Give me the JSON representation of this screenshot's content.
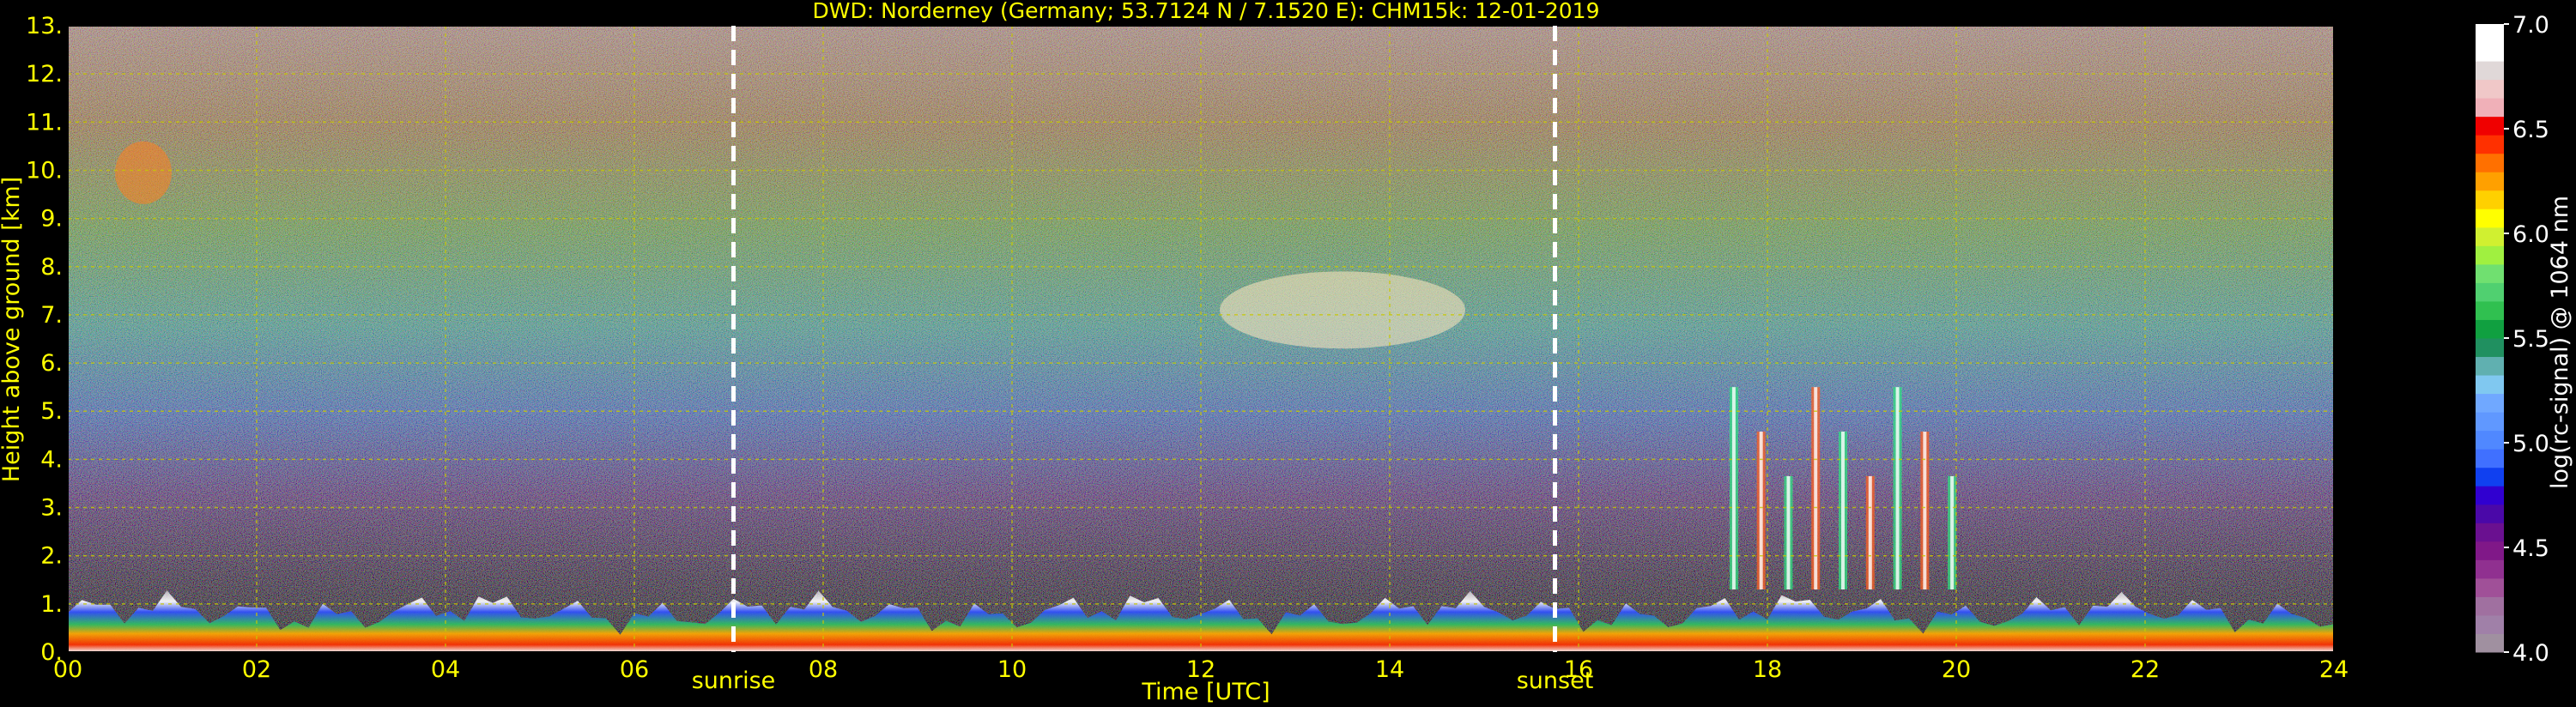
{
  "chart_data": {
    "type": "heatmap",
    "title": "DWD: Norderney (Germany; 53.7124 N / 7.1520 E):    CHM15k: 12-01-2019",
    "xlabel": "Time [UTC]",
    "ylabel": "Height above ground [km]",
    "xlim": [
      0,
      24
    ],
    "ylim": [
      0,
      13
    ],
    "x_ticks": [
      "00",
      "02",
      "04",
      "06",
      "08",
      "10",
      "12",
      "14",
      "16",
      "18",
      "20",
      "22",
      "24"
    ],
    "y_ticks": [
      "0.",
      "1.",
      "2.",
      "3.",
      "4.",
      "5.",
      "6.",
      "7.",
      "8.",
      "9.",
      "10.",
      "11.",
      "12.",
      "13."
    ],
    "grid": true,
    "annotations": [
      {
        "label": "sunrise",
        "x": 7.05
      },
      {
        "label": "sunset",
        "x": 15.75
      }
    ],
    "colorbar": {
      "label": "log(rc-signal) @ 1064 nm",
      "range": [
        4.0,
        7.0
      ],
      "ticks": [
        "4.0",
        "4.5",
        "5.0",
        "5.5",
        "6.0",
        "6.5",
        "7.0"
      ]
    },
    "features": [
      {
        "kind": "boundary-layer",
        "x_range": [
          0,
          24
        ],
        "height_km": [
          0.1,
          1.3
        ]
      },
      {
        "kind": "cirrus",
        "x_range": [
          12.2,
          14.8
        ],
        "height_km": [
          6.3,
          7.9
        ]
      },
      {
        "kind": "aerosol-plume",
        "x_range": [
          17.5,
          20.1
        ],
        "height_km": [
          1.3,
          5.5
        ]
      },
      {
        "kind": "high-layer",
        "x_range": [
          0.5,
          1.1
        ],
        "height_km": [
          9.3,
          10.6
        ]
      }
    ]
  },
  "colors": {
    "text": "#ffff00",
    "grid": "#c8c800",
    "background": "#000000",
    "colorbar_text": "#ffffff"
  }
}
